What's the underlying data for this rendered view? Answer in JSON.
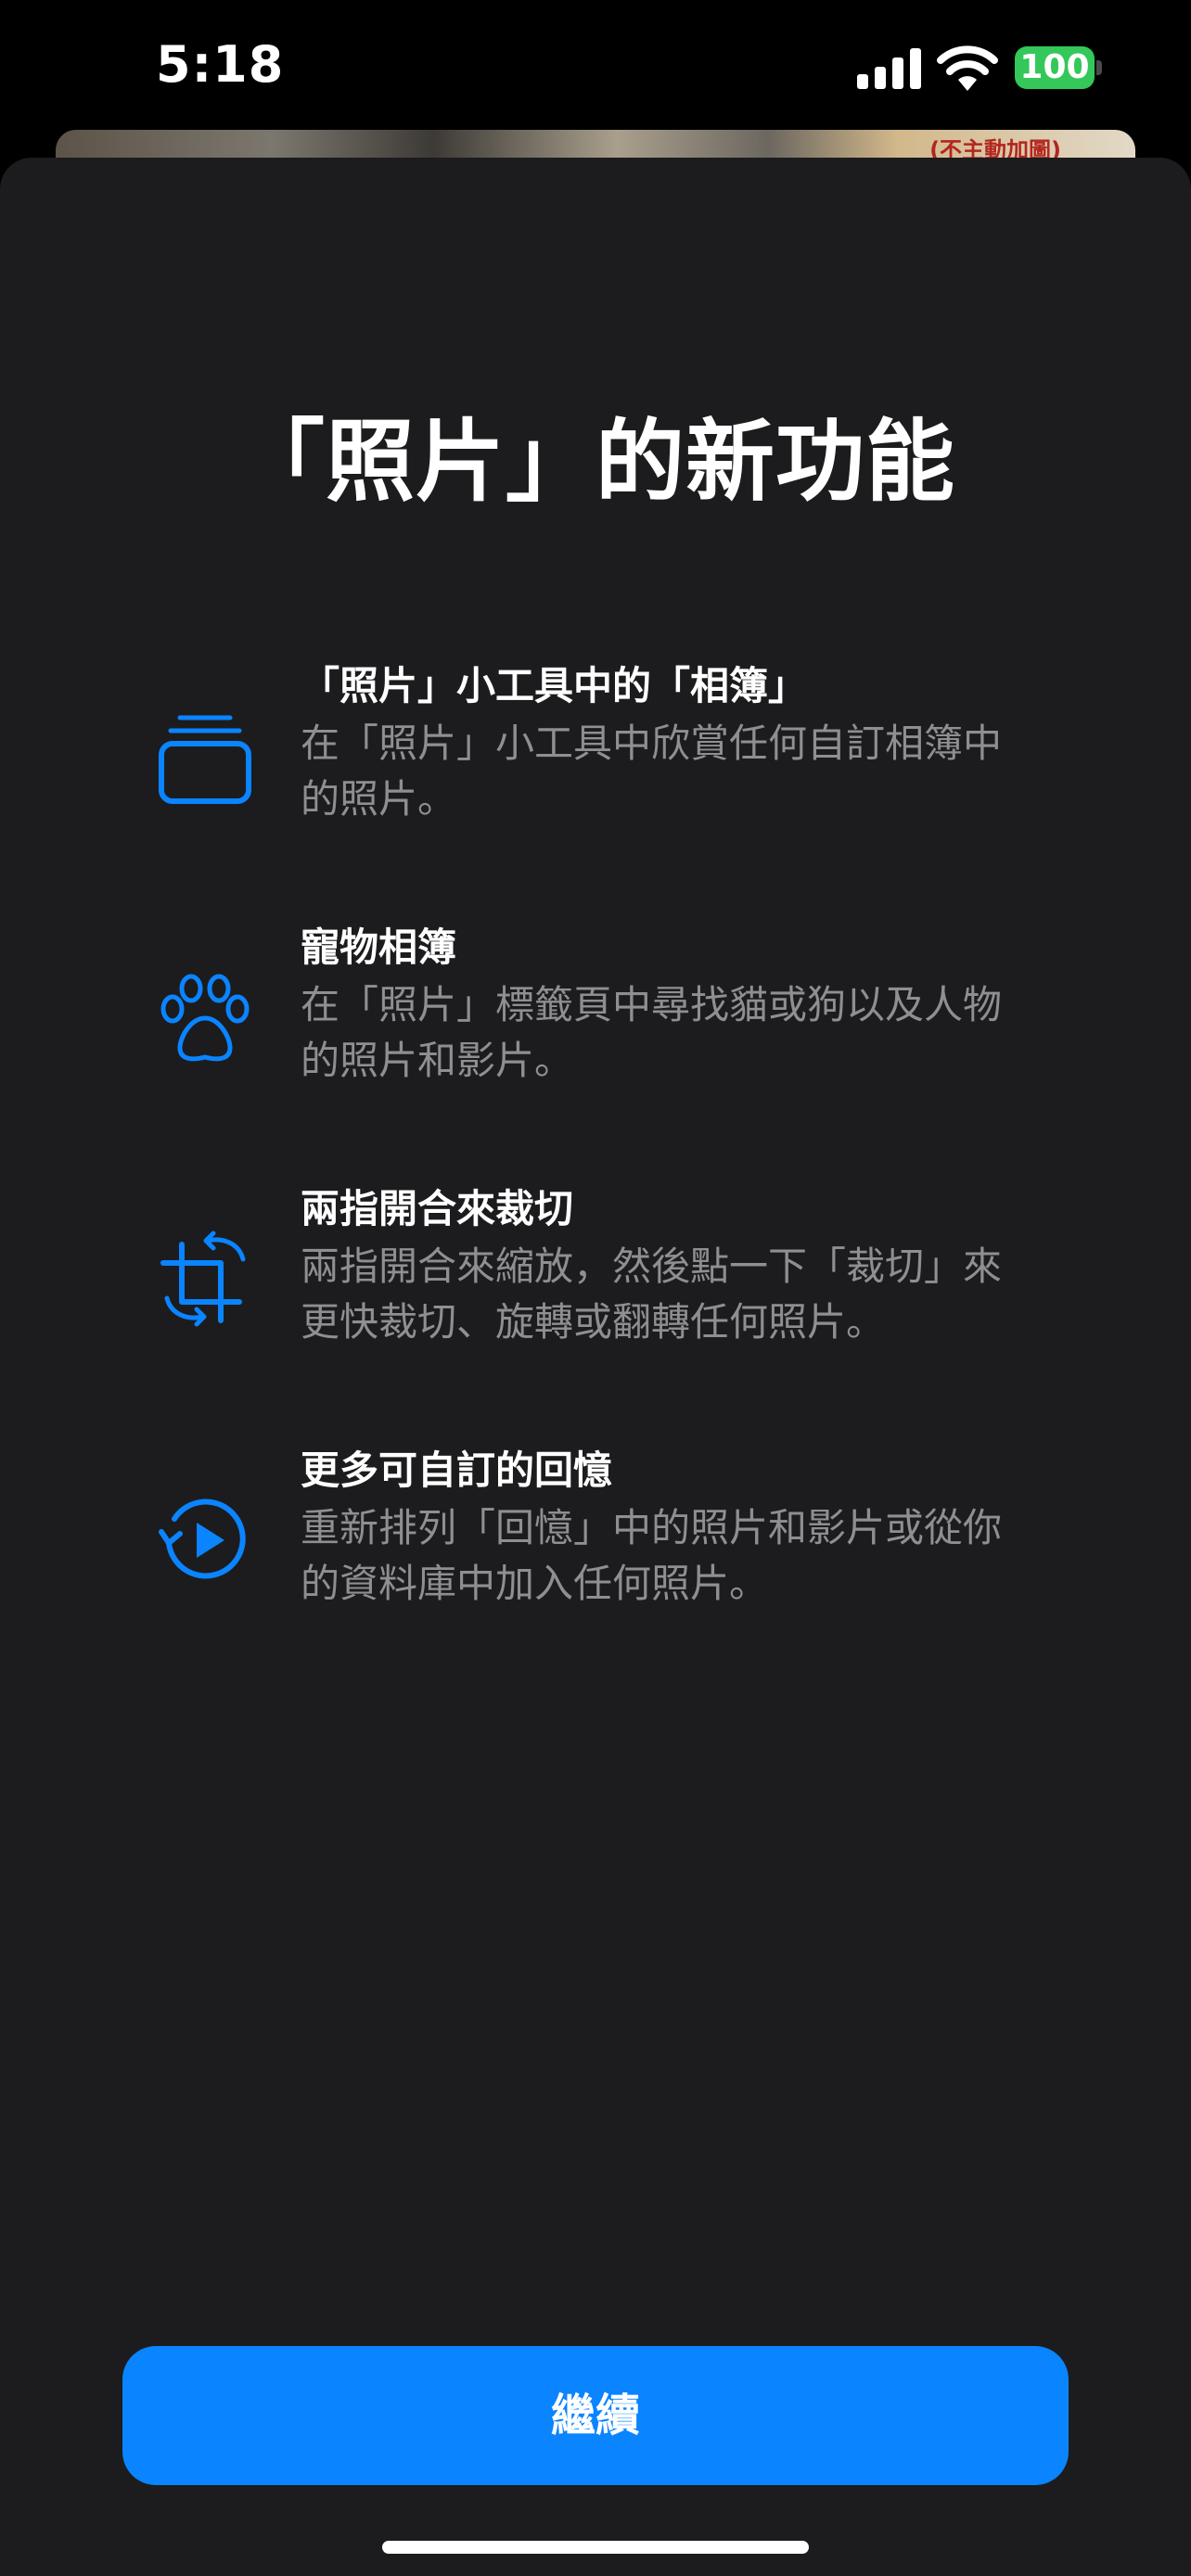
{
  "status_bar": {
    "time": "5:18",
    "battery_level": "100",
    "battery_color": "#34c759"
  },
  "background": {
    "peek_text": "(不主動加圖)"
  },
  "sheet": {
    "title": "「照片」的新功能",
    "features": [
      {
        "icon": "album-stack-icon",
        "title": "「照片」小工具中的「相簿」",
        "description": "在「照片」小工具中欣賞任何自訂相簿中的照片。"
      },
      {
        "icon": "pawprint-icon",
        "title": "寵物相簿",
        "description": "在「照片」標籤頁中尋找貓或狗以及人物的照片和影片。"
      },
      {
        "icon": "crop-rotate-icon",
        "title": "兩指開合來裁切",
        "description": "兩指開合來縮放，然後點一下「裁切」來更快裁切、旋轉或翻轉任何照片。"
      },
      {
        "icon": "memories-play-icon",
        "title": "更多可自訂的回憶",
        "description": "重新排列「回憶」中的照片和影片或從你的資料庫中加入任何照片。"
      }
    ],
    "continue_label": "繼續",
    "accent_color": "#0a84ff"
  }
}
